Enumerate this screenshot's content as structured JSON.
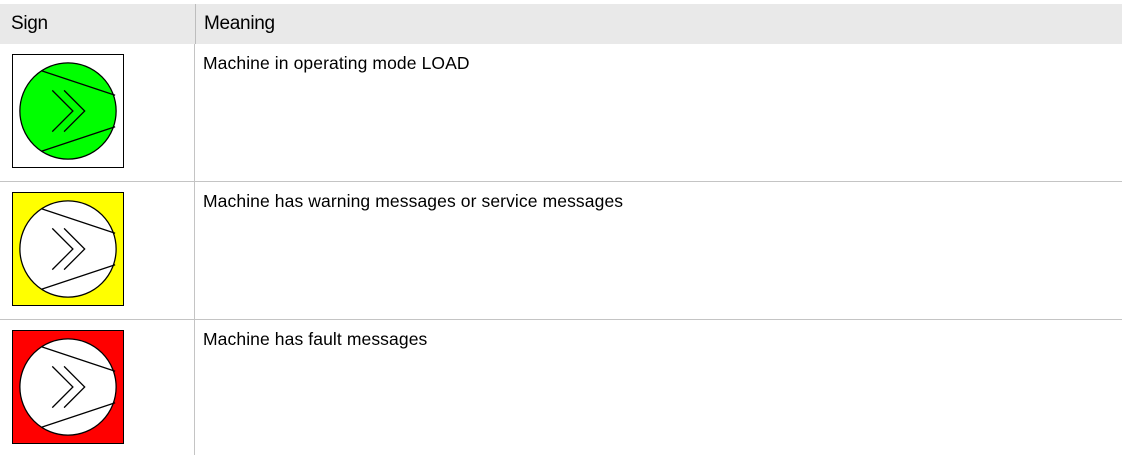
{
  "table": {
    "headers": {
      "sign": "Sign",
      "meaning": "Meaning"
    },
    "rows": [
      {
        "icon": "operating-mode-load-icon",
        "box_color": "#ffffff",
        "circle_color": "#00ff00",
        "meaning": "Machine in operating mode LOAD"
      },
      {
        "icon": "warning-messages-icon",
        "box_color": "#ffff00",
        "circle_color": "#ffffff",
        "meaning": "Machine has warning messages or service messages"
      },
      {
        "icon": "fault-messages-icon",
        "box_color": "#ff0000",
        "circle_color": "#ffffff",
        "meaning": "Machine has fault messages"
      }
    ]
  }
}
